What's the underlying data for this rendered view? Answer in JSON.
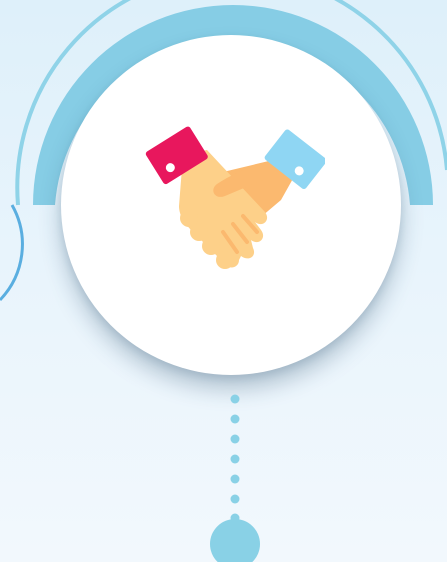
{
  "colors": {
    "ring_outer": "#8fd3e8",
    "ring_inner": "#7ecbe3",
    "left_arc": "#5aaee0",
    "card": "#ffffff",
    "cuff_left": "#e8175d",
    "cuff_right": "#8fd6f3",
    "skin_light": "#fdd089",
    "skin_dark": "#fbb96f",
    "dot": "#89d1e6",
    "terminal": "#89d1e6"
  },
  "icon": "handshake-icon"
}
